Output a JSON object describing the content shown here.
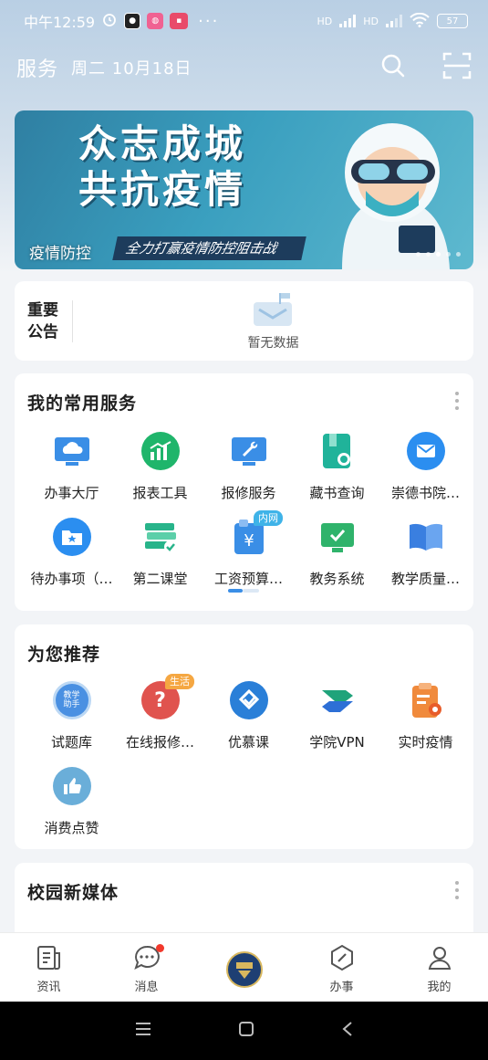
{
  "status_bar": {
    "time": "中午12:59",
    "more": "···",
    "net1": "HD",
    "net2": "HD",
    "battery": "57"
  },
  "header": {
    "title": "服务",
    "date": "周二 10月18日"
  },
  "banner": {
    "title_line1": "众志成城",
    "title_line2": "共抗疫情",
    "subtitle": "全力打赢疫情防控阻击战",
    "caption": "疫情防控"
  },
  "notice": {
    "label_line1": "重要",
    "label_line2": "公告",
    "empty_text": "暂无数据"
  },
  "common_services": {
    "title": "我的常用服务",
    "items": [
      {
        "label": "办事大厅",
        "icon": "monitor-cloud-icon",
        "color": "#3a8ee6"
      },
      {
        "label": "报表工具",
        "icon": "chart-icon",
        "color": "#1fb56b"
      },
      {
        "label": "报修服务",
        "icon": "monitor-wrench-icon",
        "color": "#3a8ee6"
      },
      {
        "label": "藏书查询",
        "icon": "book-search-icon",
        "color": "#20b39a"
      },
      {
        "label": "崇德书院…",
        "icon": "mail-icon",
        "color": "#2b8ef0"
      },
      {
        "label": "待办事项（…",
        "icon": "folder-star-icon",
        "color": "#2b8ef0"
      },
      {
        "label": "第二课堂",
        "icon": "books-check-icon",
        "color": "#28b48a"
      },
      {
        "label": "工资预算…",
        "icon": "wallet-yen-icon",
        "color": "#3a8ee6",
        "tag": "内网"
      },
      {
        "label": "教务系统",
        "icon": "screen-check-icon",
        "color": "#2fb36b"
      },
      {
        "label": "教学质量…",
        "icon": "open-book-icon",
        "color": "#3a7fe0"
      }
    ]
  },
  "recommend": {
    "title": "为您推荐",
    "items": [
      {
        "label": "试题库",
        "icon": "teaching-assistant-icon",
        "color": "#4a90e2",
        "icon_text_1": "教学",
        "icon_text_2": "助手"
      },
      {
        "label": "在线报修…",
        "icon": "question-icon",
        "color": "#e0534e",
        "tag": "生活"
      },
      {
        "label": "优慕课",
        "icon": "umooc-icon",
        "color": "#2a7fd8"
      },
      {
        "label": "学院VPN",
        "icon": "vpn-icon",
        "color": "#1fa37a"
      },
      {
        "label": "实时疫情",
        "icon": "clipboard-virus-icon",
        "color": "#f08a3c"
      },
      {
        "label": "消费点赞",
        "icon": "thumbs-up-icon",
        "color": "#6aaed9"
      }
    ]
  },
  "new_media": {
    "title": "校园新媒体"
  },
  "bottom_nav": {
    "items": [
      {
        "label": "资讯",
        "icon": "news-icon"
      },
      {
        "label": "消息",
        "icon": "chat-icon"
      },
      {
        "label": "",
        "icon": "school-logo-icon"
      },
      {
        "label": "办事",
        "icon": "compass-icon"
      },
      {
        "label": "我的",
        "icon": "user-icon"
      }
    ]
  }
}
